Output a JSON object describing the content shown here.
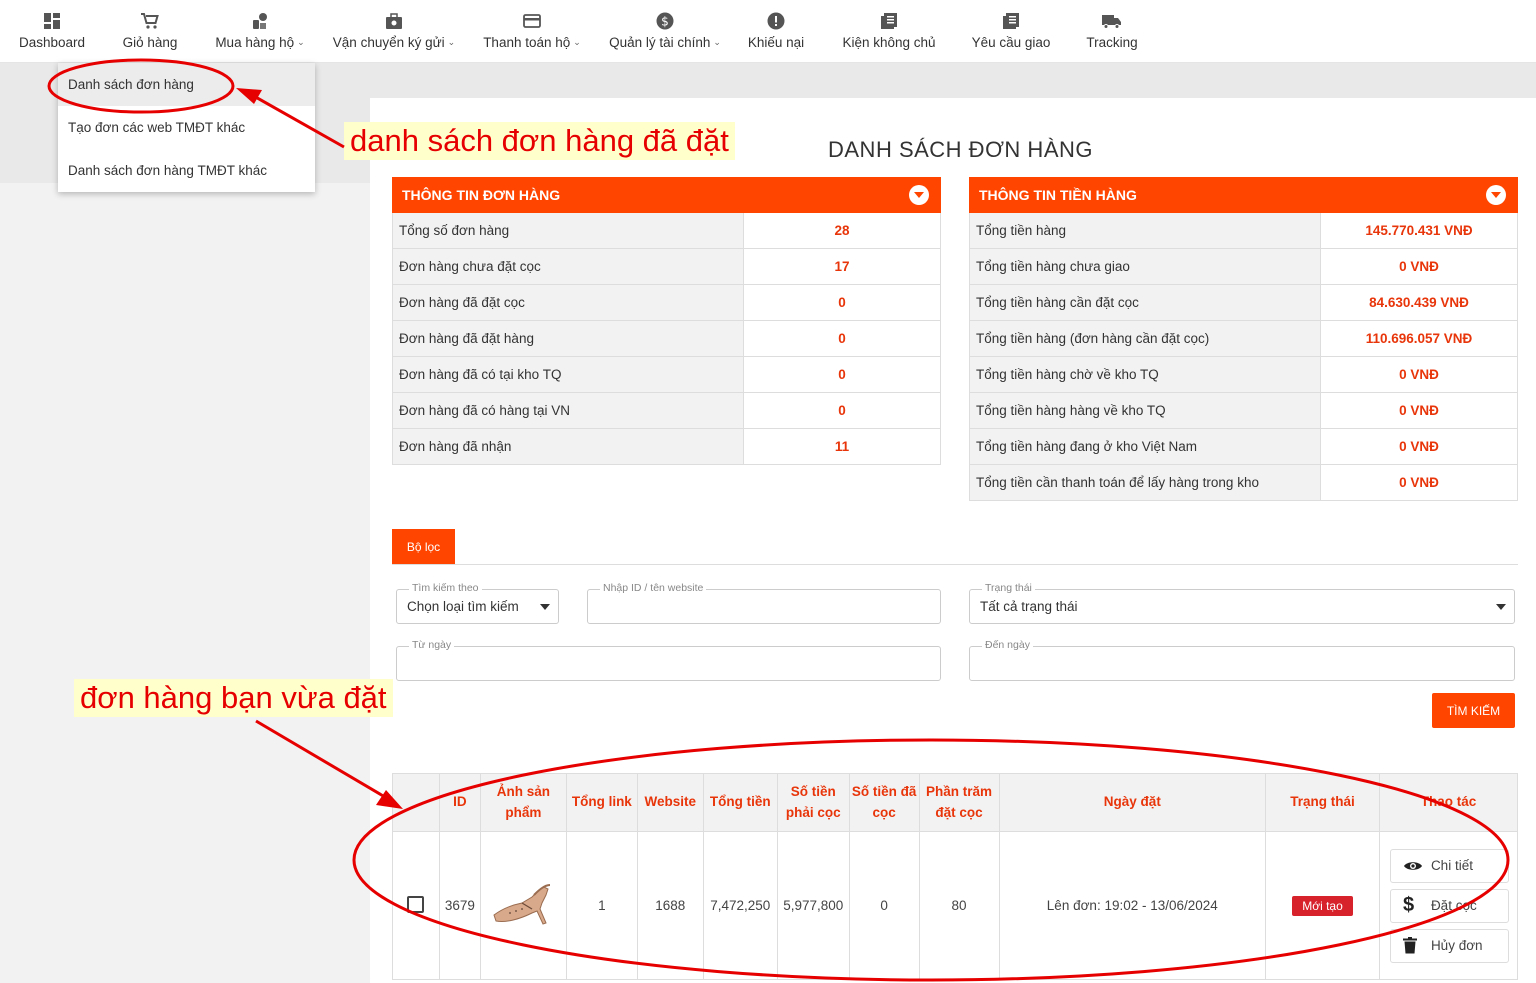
{
  "nav": {
    "items": [
      {
        "label": "Dashboard",
        "icon": "dashboard-icon"
      },
      {
        "label": "Giỏ hàng",
        "icon": "cart-icon"
      },
      {
        "label": "Mua hàng hộ",
        "icon": "buy-icon",
        "has_caret": true
      },
      {
        "label": "Vận chuyển ký gửi",
        "icon": "shipping-box-icon",
        "has_caret": true
      },
      {
        "label": "Thanh toán hộ",
        "icon": "card-icon",
        "has_caret": true
      },
      {
        "label": "Quản lý tài chính",
        "icon": "dollar-icon",
        "has_caret": true
      },
      {
        "label": "Khiếu nại",
        "icon": "alert-icon"
      },
      {
        "label": "Kiện không chủ",
        "icon": "package-list-icon"
      },
      {
        "label": "Yêu cầu giao",
        "icon": "request-list-icon"
      },
      {
        "label": "Tracking",
        "icon": "truck-icon"
      }
    ]
  },
  "dropdown": {
    "items": [
      "Danh sách đơn hàng",
      "Tạo đơn các web TMĐT khác",
      "Danh sách đơn hàng TMĐT khác"
    ]
  },
  "page": {
    "title": "DANH SÁCH ĐƠN HÀNG"
  },
  "order_info": {
    "title": "THÔNG TIN ĐƠN HÀNG",
    "rows": [
      {
        "label": "Tổng số đơn hàng",
        "value": "28"
      },
      {
        "label": "Đơn hàng chưa đặt cọc",
        "value": "17"
      },
      {
        "label": "Đơn hàng đã đặt cọc",
        "value": "0"
      },
      {
        "label": "Đơn hàng đã đặt hàng",
        "value": "0"
      },
      {
        "label": "Đơn hàng đã có tại kho TQ",
        "value": "0"
      },
      {
        "label": "Đơn hàng đã có hàng tại VN",
        "value": "0"
      },
      {
        "label": "Đơn hàng đã nhận",
        "value": "11"
      }
    ]
  },
  "money_info": {
    "title": "THÔNG TIN TIỀN HÀNG",
    "rows": [
      {
        "label": "Tổng tiền hàng",
        "value": "145.770.431 VNĐ"
      },
      {
        "label": "Tổng tiền hàng chưa giao",
        "value": "0 VNĐ"
      },
      {
        "label": "Tổng tiền hàng cần đặt cọc",
        "value": "84.630.439 VNĐ"
      },
      {
        "label": "Tổng tiền hàng (đơn hàng cần đặt cọc)",
        "value": "110.696.057 VNĐ"
      },
      {
        "label": "Tổng tiền hàng chờ về kho TQ",
        "value": "0 VNĐ"
      },
      {
        "label": "Tổng tiền hàng hàng về kho TQ",
        "value": "0 VNĐ"
      },
      {
        "label": "Tổng tiền hàng đang ở kho Việt Nam",
        "value": "0 VNĐ"
      },
      {
        "label": "Tổng tiền cần thanh toán để lấy hàng trong kho",
        "value": "0 VNĐ"
      }
    ]
  },
  "filter": {
    "tab_label": "Bộ lọc",
    "search_by_label": "Tìm kiếm theo",
    "search_by_value": "Chọn loại tìm kiếm",
    "id_label": "Nhập ID / tên website",
    "id_value": "",
    "status_label": "Trạng thái",
    "status_value": "Tất cả trạng thái",
    "from_label": "Từ ngày",
    "to_label": "Đến ngày",
    "search_button": "TÌM KIẾM"
  },
  "table": {
    "headers": [
      "",
      "ID",
      "Ảnh sản phẩm",
      "Tổng link",
      "Website",
      "Tổng tiền",
      "Số tiền phải cọc",
      "Số tiền đã cọc",
      "Phần trăm đặt cọc",
      "Ngày đặt",
      "Trạng thái",
      "Thao tác"
    ],
    "rows": [
      {
        "id": "3679",
        "product_image": "shoe-image",
        "total_links": "1",
        "website": "1688",
        "total": "7,472,250",
        "deposit_required": "5,977,800",
        "deposit_paid": "0",
        "deposit_percent": "80",
        "order_date": "Lên đơn: 19:02 - 13/06/2024",
        "status": "Mới tạo",
        "actions": [
          "Chi tiết",
          "Đặt cọc",
          "Hủy đơn"
        ]
      }
    ]
  },
  "annotations": {
    "top": "danh sách đơn hàng đã đặt",
    "bottom": "đơn hàng bạn vừa đặt"
  },
  "colors": {
    "accent": "#ff4500",
    "value_red": "#e8350a",
    "badge_red": "#d7222c",
    "annotation_red": "#e60000"
  }
}
